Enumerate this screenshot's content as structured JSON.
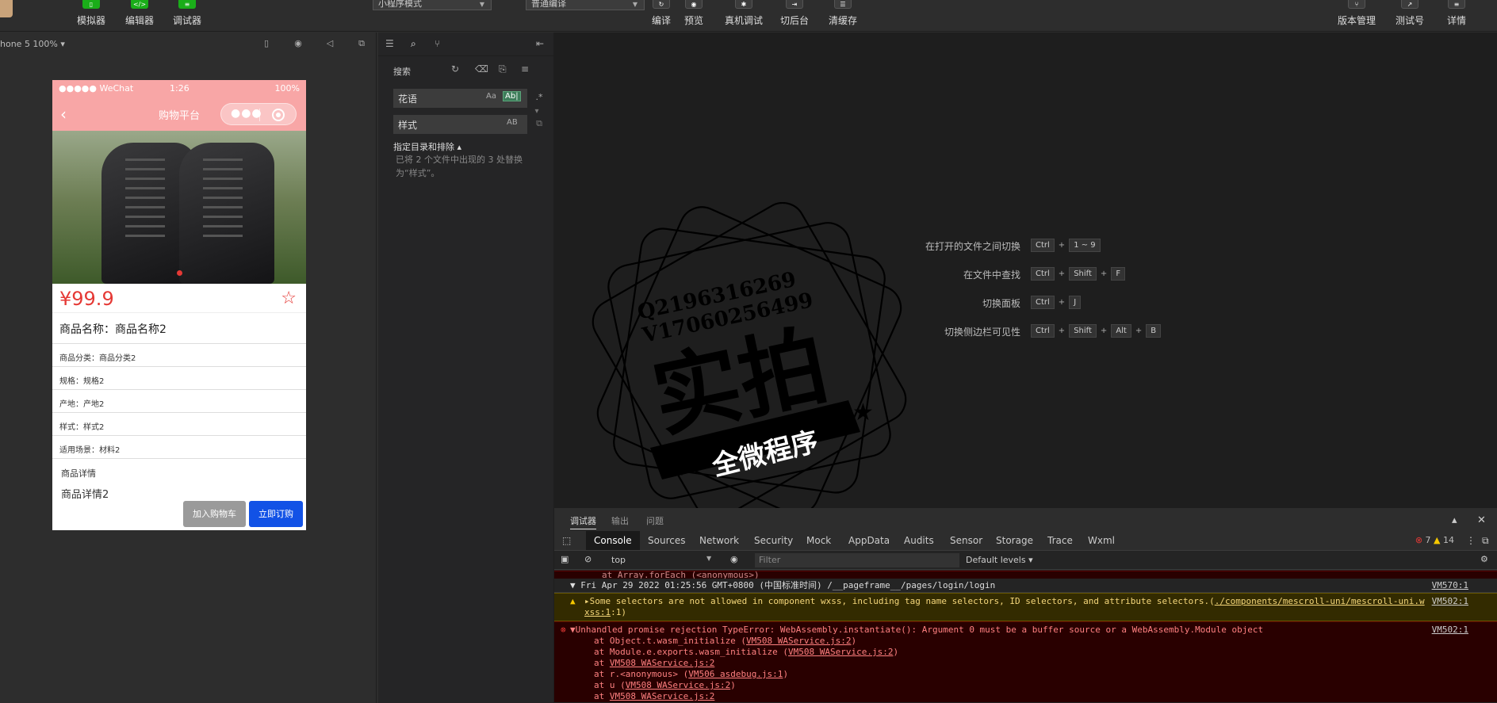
{
  "toolbar": {
    "left_buttons": [
      "模拟器",
      "编辑器",
      "调试器"
    ],
    "mode_select": "小程序模式",
    "compile_select": "普通编译",
    "mid_buttons": [
      "编译",
      "预览",
      "真机调试",
      "切后台",
      "清缓存"
    ],
    "right_buttons": [
      "版本管理",
      "测试号",
      "详情"
    ],
    "accent_color": "#1aad19"
  },
  "simulator": {
    "device": "hone 5 100% ▾",
    "status": {
      "carrier": "●●●●● WeChat",
      "time": "1:26",
      "battery": "100%"
    },
    "nav_title": "购物平台",
    "price": "¥99.9",
    "product_name": "商品名称：商品名称2",
    "attrs": [
      "商品分类：商品分类2",
      "规格：规格2",
      "产地：产地2",
      "样式：样式2",
      "适用场景：材料2"
    ],
    "detail_title": "商品详情",
    "detail_text": "商品详情2",
    "cart_button": "加入购物车",
    "buy_button": "立即订购",
    "header_color": "#f8a6a6",
    "price_color": "#e53935",
    "buy_color": "#1252e6"
  },
  "search": {
    "title": "搜索",
    "query": "花语",
    "query_options": [
      "Aa",
      "Ab|"
    ],
    "replace": "样式",
    "replace_option": "AB",
    "scope_label": "指定目录和排除 ▴",
    "result_text": "已将 2 个文件中出现的 3 处替换为“样式”。"
  },
  "shortcuts": [
    {
      "label": "在打开的文件之间切换",
      "keys": [
        "Ctrl",
        "+",
        "1 ~ 9"
      ]
    },
    {
      "label": "在文件中查找",
      "keys": [
        "Ctrl",
        "+",
        "Shift",
        "+",
        "F"
      ]
    },
    {
      "label": "切换面板",
      "keys": [
        "Ctrl",
        "+",
        "J"
      ]
    },
    {
      "label": "切换侧边栏可见性",
      "keys": [
        "Ctrl",
        "+",
        "Shift",
        "+",
        "Alt",
        "+",
        "B"
      ]
    }
  ],
  "watermark": {
    "line1": "Q2196316269",
    "line2": "V17060256499",
    "big": "实拍",
    "banner": "全微程序"
  },
  "debugger": {
    "panel_tabs": [
      "调试器",
      "输出",
      "问题"
    ],
    "dev_tabs": [
      "Console",
      "Sources",
      "Network",
      "Security",
      "Mock",
      "AppData",
      "Audits",
      "Sensor",
      "Storage",
      "Trace",
      "Wxml"
    ],
    "error_count": "7",
    "warn_count": "14",
    "context": "top",
    "filter_placeholder": "Filter",
    "levels": "Default levels ▾",
    "console": {
      "truncated": "at Array.forEach (<anonymous>)",
      "group": "▼ Fri Apr 29 2022 01:25:56 GMT+0800 (中国标准时间) /__pageframe__/pages/login/login",
      "group_src": "VM570:1",
      "warn_pre": "▸Some selectors are not allowed in component wxss, including tag name selectors, ID selectors, and attribute selectors.(",
      "warn_link": "./components/mescroll-uni/mescroll-uni.w",
      "warn_link2": "xss:1",
      "warn_post": ":1)",
      "warn_src": "VM502:1",
      "error_head": "▼Unhandled promise rejection TypeError: WebAssembly.instantiate(): Argument 0 must be a buffer source or a WebAssembly.Module object",
      "error_src": "VM502:1",
      "stack": [
        {
          "pre": "at Object.t.wasm_initialize (",
          "link": "VM508 WAService.js:2",
          "post": ")"
        },
        {
          "pre": "at Module.e.exports.wasm_initialize (",
          "link": "VM508 WAService.js:2",
          "post": ")"
        },
        {
          "pre": "at ",
          "link": "VM508 WAService.js:2",
          "post": ""
        },
        {
          "pre": "at r.<anonymous> (",
          "link": "VM506 asdebug.js:1",
          "post": ")"
        },
        {
          "pre": "at u (",
          "link": "VM508 WAService.js:2",
          "post": ")"
        },
        {
          "pre": "at ",
          "link": "VM508 WAService.js:2",
          "post": ""
        }
      ]
    }
  }
}
